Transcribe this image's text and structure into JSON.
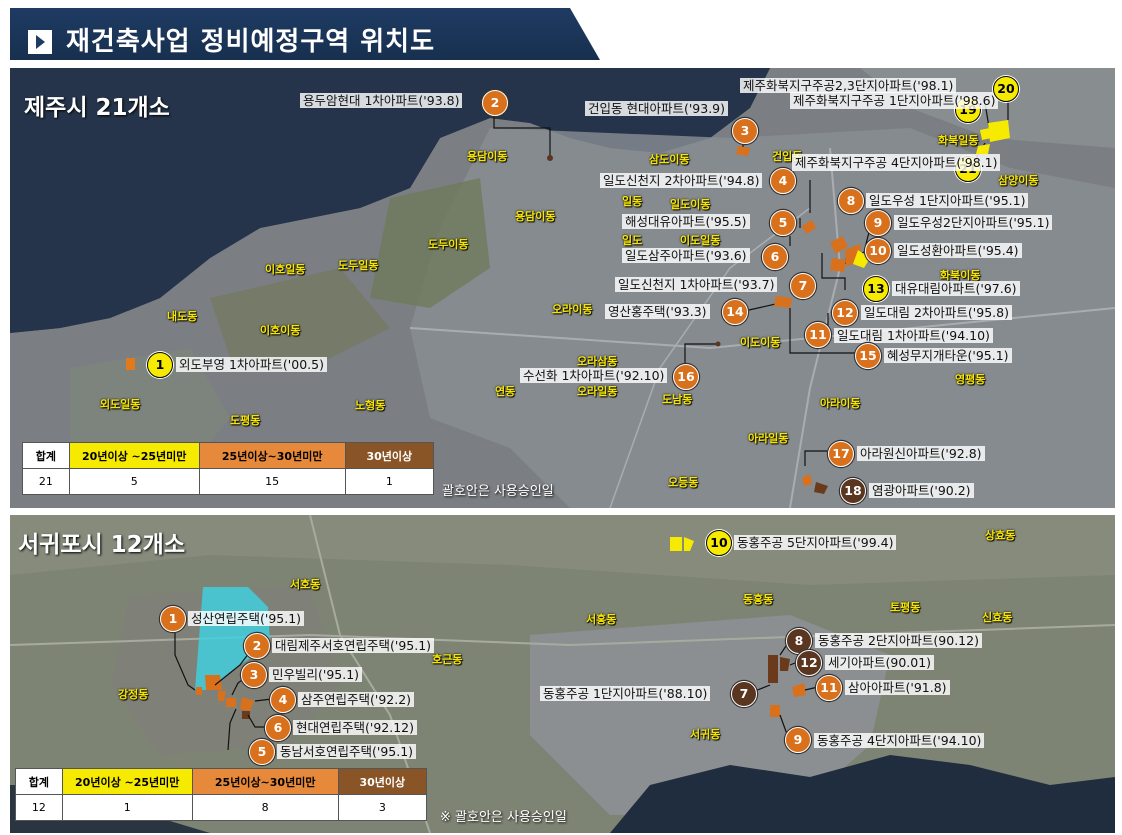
{
  "page": {
    "title": "재건축사업 정비예정구역 위치도"
  },
  "colors": {
    "band_20_25": "#f6ea00",
    "band_25_30": "#e7893a",
    "band_30_plus": "#8a5526",
    "dong_label": "#f7e600"
  },
  "jeju": {
    "title": "제주시 21개소",
    "note": "괄호안은 사용승인일",
    "legend": {
      "headers": [
        "합계",
        "20년이상 ~25년미만",
        "25년이상~30년미만",
        "30년이상"
      ],
      "values": [
        "21",
        "5",
        "15",
        "1"
      ]
    },
    "dongs": [
      "용담이동",
      "삼도이동",
      "건입동",
      "일도이동",
      "용담이동",
      "도두이동",
      "일동",
      "일도",
      "이도일동",
      "이호일동",
      "도두일동",
      "화북이동",
      "오라이동",
      "이호이동",
      "내도동",
      "오라삼동",
      "이도이동",
      "영평동",
      "외도일동",
      "연동",
      "오라일동",
      "도남동",
      "아라이동",
      "도평동",
      "노형동",
      "아라일동",
      "오등동",
      "화북일동",
      "삼양이동"
    ],
    "sites": [
      {
        "no": "1",
        "name": "외도부영 1차아파트('00.5)"
      },
      {
        "no": "2",
        "name": "용두암현대 1차아파트('93.8)"
      },
      {
        "no": "3",
        "name": "건입동 현대아파트('93.9)"
      },
      {
        "no": "4",
        "name": "일도신천지 2차아파트('94.8)"
      },
      {
        "no": "5",
        "name": "해성대유아파트('95.5)"
      },
      {
        "no": "6",
        "name": "일도삼주아파트('93.6)"
      },
      {
        "no": "7",
        "name": "일도신천지 1차아파트('93.7)"
      },
      {
        "no": "8",
        "name": "일도우성 1단지아파트('95.1)"
      },
      {
        "no": "9",
        "name": "일도우성2단지아파트('95.1)"
      },
      {
        "no": "10",
        "name": "일도성환아파트('95.4)"
      },
      {
        "no": "11",
        "name": "일도대림 1차아파트('94.10)"
      },
      {
        "no": "12",
        "name": "일도대림 2차아파트('95.8)"
      },
      {
        "no": "13",
        "name": "대유대림아파트('97.6)"
      },
      {
        "no": "14",
        "name": "영산홍주택('93.3)"
      },
      {
        "no": "15",
        "name": "혜성무지개타운('95.1)"
      },
      {
        "no": "16",
        "name": "수선화 1차아파트('92.10)"
      },
      {
        "no": "17",
        "name": "아라원신아파트('92.8)"
      },
      {
        "no": "18",
        "name": "염광아파트('90.2)"
      },
      {
        "no": "19",
        "name": "제주화북지구주공 1단지아파트('98.6)"
      },
      {
        "no": "20",
        "name": "제주화북지구주공2,3단지아파트('98.1)"
      },
      {
        "no": "21",
        "name": "제주화북지구주공 4단지아파트('98.1)"
      }
    ]
  },
  "seogwipo": {
    "title": "서귀포시 12개소",
    "note": "※ 괄호안은 사용승인일",
    "legend": {
      "headers": [
        "합계",
        "20년이상 ~25년미만",
        "25년이상~30년미만",
        "30년이상"
      ],
      "values": [
        "12",
        "1",
        "8",
        "3"
      ]
    },
    "dongs": [
      "상효동",
      "서호동",
      "동홍동",
      "토평동",
      "신효동",
      "서홍동",
      "호근동",
      "강정동",
      "서귀동"
    ],
    "sites": [
      {
        "no": "1",
        "name": "성산연립주택('95.1)"
      },
      {
        "no": "2",
        "name": "대림제주서호연립주택('95.1)"
      },
      {
        "no": "3",
        "name": "민우빌리('95.1)"
      },
      {
        "no": "4",
        "name": "삼주연립주택('92.2)"
      },
      {
        "no": "5",
        "name": "동남서호연립주택('95.1)"
      },
      {
        "no": "6",
        "name": "현대연립주택('92.12)"
      },
      {
        "no": "7",
        "name": "동홍주공 1단지아파트('88.10)"
      },
      {
        "no": "8",
        "name": "동홍주공 2단지아파트(90.12)"
      },
      {
        "no": "9",
        "name": "동홍주공 4단지아파트('94.10)"
      },
      {
        "no": "10",
        "name": "동홍주공 5단지아파트('99.4)"
      },
      {
        "no": "11",
        "name": "삼아아파트('91.8)"
      },
      {
        "no": "12",
        "name": "세기아파트(90.01)"
      }
    ]
  }
}
